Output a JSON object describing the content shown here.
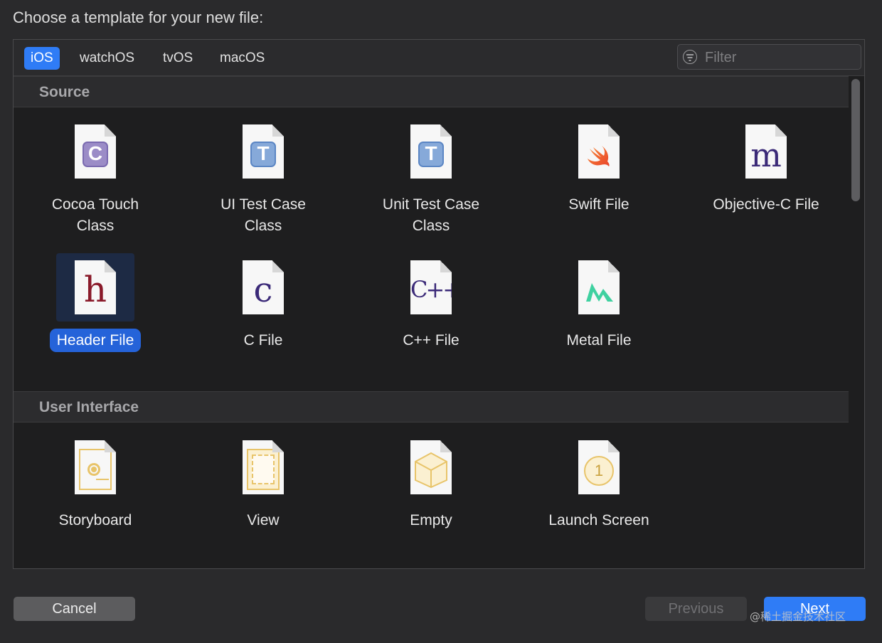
{
  "dialog": {
    "title": "Choose a template for your new file:"
  },
  "platform_tabs": [
    {
      "label": "iOS",
      "active": true
    },
    {
      "label": "watchOS",
      "active": false
    },
    {
      "label": "tvOS",
      "active": false
    },
    {
      "label": "macOS",
      "active": false
    }
  ],
  "filter": {
    "placeholder": "Filter",
    "value": ""
  },
  "sections": [
    {
      "title": "Source",
      "items": [
        {
          "label_lines": [
            "Cocoa Touch",
            "Class"
          ],
          "icon": "cocoa-touch-class-icon",
          "glyph": "C"
        },
        {
          "label_lines": [
            "UI Test Case",
            "Class"
          ],
          "icon": "ui-test-case-icon",
          "glyph": "T"
        },
        {
          "label_lines": [
            "Unit Test Case",
            "Class"
          ],
          "icon": "unit-test-case-icon",
          "glyph": "T"
        },
        {
          "label_lines": [
            "Swift File"
          ],
          "icon": "swift-file-icon",
          "glyph": ""
        },
        {
          "label_lines": [
            "Objective-C File"
          ],
          "icon": "objective-c-file-icon",
          "glyph": "m"
        },
        {
          "label_lines": [
            "Header File"
          ],
          "icon": "header-file-icon",
          "glyph": "h",
          "selected": true
        },
        {
          "label_lines": [
            "C File"
          ],
          "icon": "c-file-icon",
          "glyph": "c"
        },
        {
          "label_lines": [
            "C++ File"
          ],
          "icon": "cpp-file-icon",
          "glyph": "C++"
        },
        {
          "label_lines": [
            "Metal File"
          ],
          "icon": "metal-file-icon",
          "glyph": ""
        }
      ]
    },
    {
      "title": "User Interface",
      "items": [
        {
          "label_lines": [
            "Storyboard"
          ],
          "icon": "storyboard-icon",
          "glyph": ""
        },
        {
          "label_lines": [
            "View"
          ],
          "icon": "view-icon",
          "glyph": ""
        },
        {
          "label_lines": [
            "Empty"
          ],
          "icon": "empty-icon",
          "glyph": ""
        },
        {
          "label_lines": [
            "Launch Screen"
          ],
          "icon": "launch-screen-icon",
          "glyph": "1"
        }
      ]
    }
  ],
  "buttons": {
    "cancel": "Cancel",
    "previous": "Previous",
    "next": "Next"
  },
  "watermark": "@稀土掘金技术社区",
  "colors": {
    "accent": "#2f7cf6",
    "selection": "#2563d9",
    "background": "#1e1e1f"
  }
}
